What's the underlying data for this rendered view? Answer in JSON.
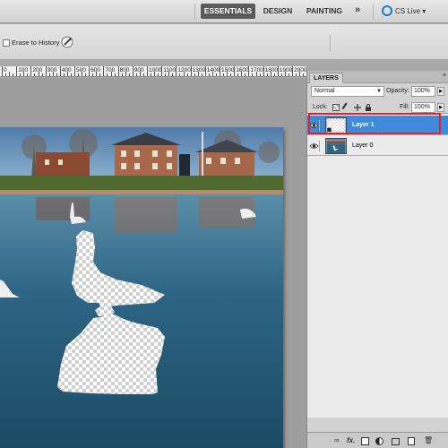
{
  "workspace": {
    "tabs": [
      {
        "label": "ESSENTIALS",
        "active": true
      },
      {
        "label": "DESIGN",
        "active": false
      },
      {
        "label": "PAINTING",
        "active": false
      }
    ],
    "more_label": "»",
    "cslive_label": "CS Live ▾"
  },
  "options": {
    "erase_to_history_label": "Erase to History"
  },
  "ruler": {
    "labels": [
      "0",
      "100",
      "200",
      "300",
      "400",
      "500",
      "600",
      "700",
      "800",
      "900",
      "1000",
      "1100",
      "1200",
      "1300",
      "1400",
      "1500",
      "1600",
      "1700",
      "1800",
      "1900",
      "2000",
      "2100"
    ]
  },
  "layers_panel": {
    "tab_label": "LAYERS",
    "blend_mode": "Normal",
    "opacity_label": "Opacity:",
    "opacity_value": "100%",
    "lock_label": "Lock:",
    "fill_label": "Fill:",
    "fill_value": "100%",
    "layers": [
      {
        "name": "Layer 1",
        "selected": true,
        "visible": true
      },
      {
        "name": "Layer 0",
        "selected": false,
        "visible": true
      }
    ],
    "footer_fx": "fx."
  },
  "colors": {
    "selection_blue": "#3e8bdc",
    "highlight_red": "#e0242f",
    "cslive_blue": "#1a7fc4"
  }
}
